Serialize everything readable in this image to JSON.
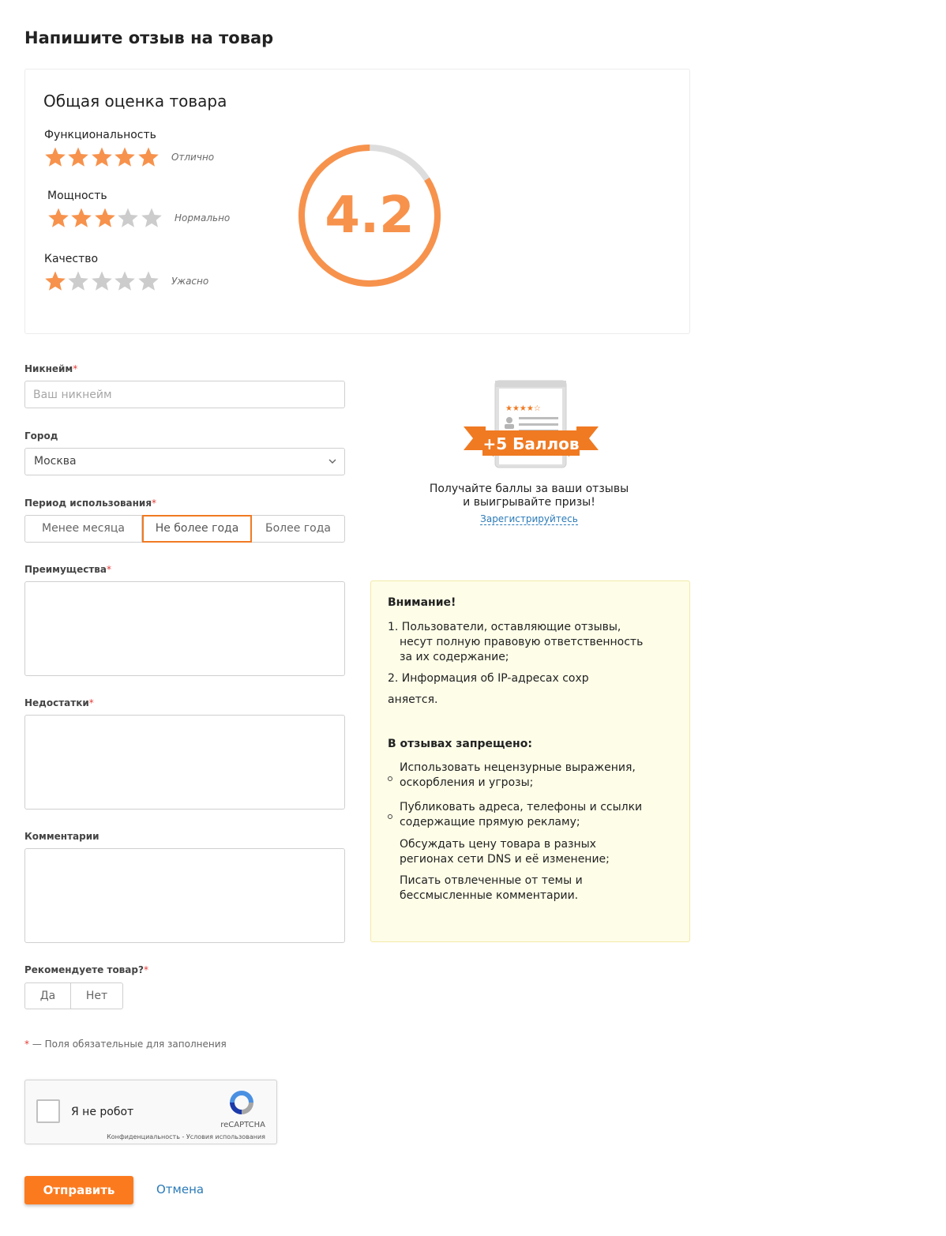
{
  "page": {
    "title": "Напишите отзыв на товар"
  },
  "rating": {
    "card_title": "Общая оценка товара",
    "overall": "4.2",
    "overall_fraction": 0.84,
    "colors": {
      "star_on": "#f7924c",
      "star_off": "#cccccc",
      "gauge": "#f7924c",
      "gauge_track": "#dddddd"
    },
    "criteria": [
      {
        "label": "Функциональность",
        "stars": 5,
        "verdict": "Отлично"
      },
      {
        "label": "Мощность",
        "stars": 3,
        "verdict": "Нормально"
      },
      {
        "label": "Качество",
        "stars": 1,
        "verdict": "Ужасно"
      }
    ]
  },
  "form": {
    "nickname": {
      "label": "Никнейм",
      "required_mark": "*",
      "placeholder": "Ваш никнейм",
      "value": ""
    },
    "city": {
      "label": "Город",
      "value": "Москва",
      "icon": "chevron-down-icon"
    },
    "period": {
      "label": "Период использования",
      "required_mark": "*",
      "options": [
        "Менее месяца",
        "Не более года",
        "Более года"
      ],
      "selected": "Не более года"
    },
    "pros": {
      "label": "Преимущества",
      "required_mark": "*"
    },
    "cons": {
      "label": "Недостатки",
      "required_mark": "*"
    },
    "comments": {
      "label": "Комментарии"
    },
    "recommend": {
      "label": "Рекомендуете товар?",
      "required_mark": "*",
      "yes": "Да",
      "no": "Нет"
    },
    "required_note_mark": "*",
    "required_note": " — Поля обязательные для заполнения",
    "submit": "Отправить",
    "cancel": "Отмена"
  },
  "captcha": {
    "label": "Я не робот",
    "brand": "reCAPTCHA",
    "links": "Конфиденциальность - Условия использования"
  },
  "promo": {
    "badge_text": "+5 Баллов",
    "line1": "Получайте баллы за ваши отзывы",
    "line2": "и выигрывайте призы!",
    "link": "Зарегистрируйтесь",
    "color": "#f07a22"
  },
  "notice": {
    "title": "Внимание!",
    "items": [
      "1. Пользователи, оставляющие отзывы,",
      "несут полную правовую ответственность",
      "за их содержание;",
      "2. Информация об IP-адресах сохр",
      "аняется."
    ],
    "forbidden_title": "В отзывах запрещено:",
    "forbidden": [
      [
        "Использовать нецензурные выражения,",
        "оскорбления и угрозы;"
      ],
      [
        "Публиковать адреса, телефоны и ссылки",
        "содержащие прямую рекламу;"
      ],
      [
        "Обсуждать цену товара в разных",
        "регионах сети DNS и её изменение;"
      ],
      [
        "Писать отвлеченные от темы и",
        "бессмысленные комментарии."
      ]
    ]
  }
}
